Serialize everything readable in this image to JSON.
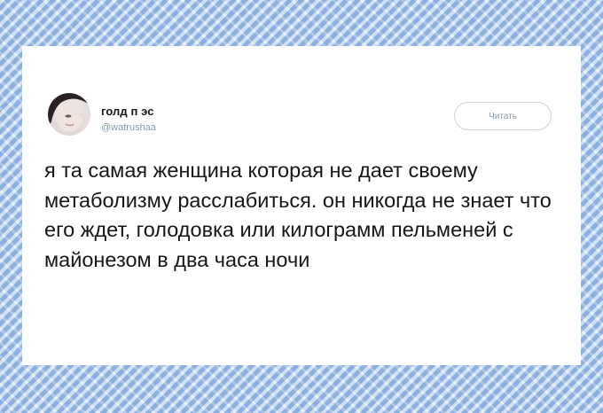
{
  "tweet": {
    "display_name": "голд п  эс",
    "handle": "@watrushaa",
    "follow_label": "Читать",
    "text": "я та самая женщина которая не дает своему метаболизму расслабиться. он никогда не знает что его ждет, голодовка или килограмм пельменей с майонезом в два часа ночи",
    "avatar_icon": "user-photo-icon"
  },
  "colors": {
    "background": "#a9c8ec",
    "card": "#ffffff",
    "text": "#14171a",
    "muted": "#8899a6",
    "button_border": "#c7d3de"
  }
}
